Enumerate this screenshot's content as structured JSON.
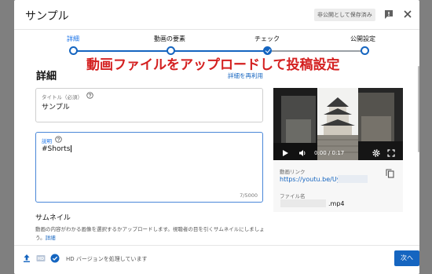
{
  "dialog": {
    "title": "サンプル",
    "save_draft_label": "非公開として保存済み"
  },
  "stepper": {
    "steps": [
      {
        "label": "詳細",
        "state": "current"
      },
      {
        "label": "動画の要素",
        "state": "pending"
      },
      {
        "label": "チェック",
        "state": "done"
      },
      {
        "label": "公開設定",
        "state": "pending"
      }
    ]
  },
  "banner": {
    "text": "動画ファイルをアップロードして投稿設定",
    "color": "#d42020"
  },
  "details": {
    "heading": "詳細",
    "reuse_link": "詳細を再利用",
    "title_field": {
      "label": "タイトル（必須）",
      "value": "サンプル"
    },
    "description_field": {
      "label": "説明",
      "value": "#Shorts",
      "char_count": "7/5000"
    }
  },
  "thumbnail": {
    "heading": "サムネイル",
    "description": "動画の内容がわかる画像を選択するかアップロードします。視聴者の目を引くサムネイルにしましょう。",
    "link": "詳細"
  },
  "preview": {
    "time": "0:00 / 0:17",
    "link_label": "動画リンク",
    "link_value": "https://youtu.be/Uyl",
    "file_label": "ファイル名",
    "file_name": ".mp4"
  },
  "footer": {
    "status": "HD バージョンを処理しています",
    "next_label": "次へ"
  },
  "colors": {
    "accent": "#1565c0",
    "link": "#1a73e8"
  },
  "icons": [
    "feedback-icon",
    "close-icon",
    "help-icon",
    "play-icon",
    "volume-icon",
    "settings-icon",
    "fullscreen-icon",
    "copy-icon",
    "upload-icon",
    "hd-icon",
    "check-circle-icon"
  ]
}
